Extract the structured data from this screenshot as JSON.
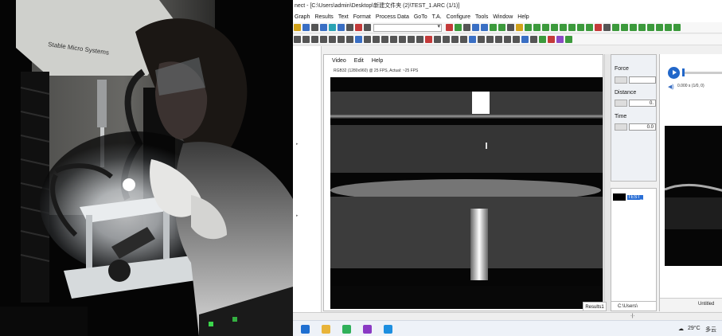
{
  "window": {
    "title": "nect - [C:\\Users\\admin\\Desktop\\新建文件夹 (2)\\TEST_1.ARC (1/1)]"
  },
  "menu": [
    "Graph",
    "Results",
    "Text",
    "Format",
    "Process Data",
    "GoTo",
    "T.A.",
    "Configure",
    "Tools",
    "Window",
    "Help"
  ],
  "video_window": {
    "menu": [
      "Video",
      "Edit",
      "Help"
    ],
    "info": "RGB32 (1280x960) @ 25 FPS, Actual: ~25 FPS"
  },
  "readouts": {
    "force_label": "Force",
    "distance_label": "Distance",
    "distance_value": "0.",
    "time_label": "Time",
    "time_value": "0.0"
  },
  "file_panel": {
    "item_label": "TEST_",
    "path": "C:\\Users\\"
  },
  "player": {
    "time_text": "0.000 s (1/0, 0)"
  },
  "results_tab": "Results1",
  "graph_status": "Untitled",
  "taskbar": {
    "temperature": "29°C",
    "weather": "多云",
    "colors": {
      "start": "#1f6fd1",
      "files": "#e8b43a",
      "chat": "#2fb05a",
      "app": "#8a3ac4",
      "edge": "#1d8fe0"
    }
  }
}
